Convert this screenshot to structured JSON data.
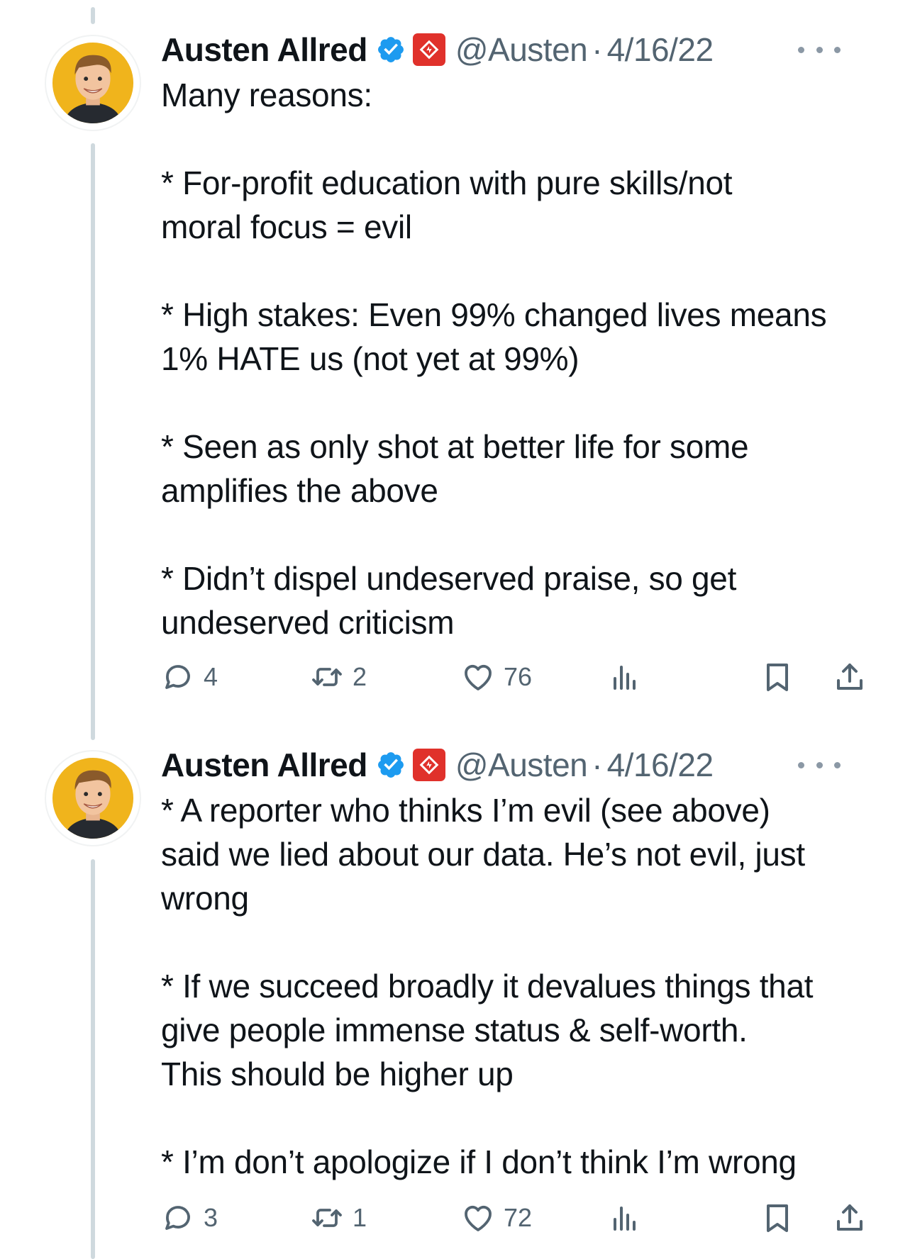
{
  "tweets": [
    {
      "author_name": "Austen Allred",
      "handle": "@Austen",
      "separator": "·",
      "date": "4/16/22",
      "paragraphs": [
        [
          "Many reasons:"
        ],
        [
          "* For-profit education with pure skills/not",
          "moral focus = evil"
        ],
        [
          "* High stakes: Even 99% changed lives means",
          "1% HATE us (not yet at 99%)"
        ],
        [
          "* Seen as only shot at better life for some",
          "amplifies the above"
        ],
        [
          "* Didn’t dispel undeserved praise, so get",
          "undeserved criticism"
        ]
      ],
      "replies": "4",
      "retweets": "2",
      "likes": "76"
    },
    {
      "author_name": "Austen Allred",
      "handle": "@Austen",
      "separator": "·",
      "date": "4/16/22",
      "paragraphs": [
        [
          "* A reporter who thinks I’m evil (see above)",
          "said we lied about our data. He’s not evil, just",
          "wrong"
        ],
        [
          "* If we succeed broadly it devalues things that",
          "give people immense status & self-worth.",
          "This should be higher up"
        ],
        [
          "* I’m don’t apologize if I don’t think I’m wrong"
        ]
      ],
      "replies": "3",
      "retweets": "1",
      "likes": "72"
    }
  ],
  "icons": {
    "verified": "verified-badge-icon",
    "affiliation": "affiliation-badge-icon",
    "more": "more-icon",
    "reply": "reply-icon",
    "retweet": "retweet-icon",
    "like": "heart-icon",
    "views": "views-icon",
    "bookmark": "bookmark-icon",
    "share": "share-icon"
  },
  "colors": {
    "verified": "#1d9bf0",
    "affiliation": "#e0312b",
    "secondary_text": "#536471",
    "thread_line": "#cfd9de"
  }
}
